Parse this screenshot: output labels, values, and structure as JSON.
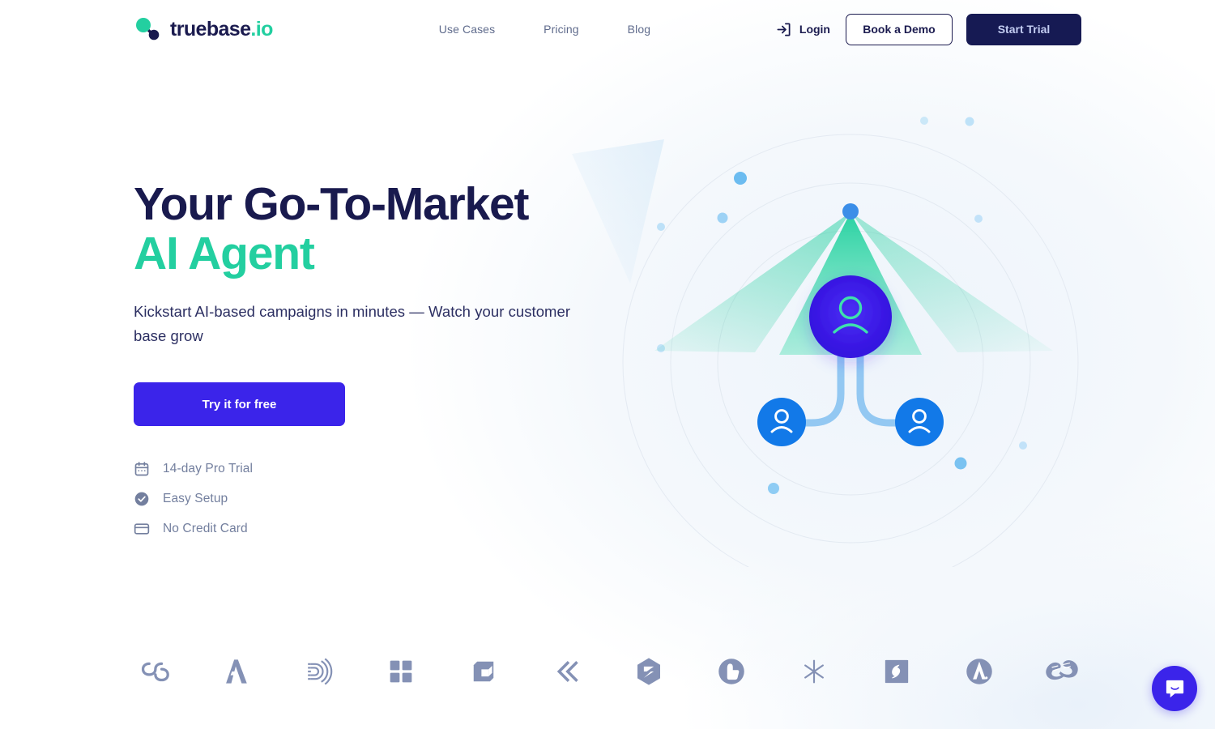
{
  "brand": {
    "name": "truebase",
    "suffix": ".io",
    "accent_teal": "#23cfa0",
    "navy": "#191a4e",
    "indigo": "#3b24ea",
    "blue": "#1279e8"
  },
  "header": {
    "nav": [
      {
        "label": "Use Cases",
        "name": "nav-use-cases"
      },
      {
        "label": "Pricing",
        "name": "nav-pricing"
      },
      {
        "label": "Blog",
        "name": "nav-blog"
      }
    ],
    "login_label": "Login",
    "demo_label": "Book a Demo",
    "trial_label": "Start Trial"
  },
  "hero": {
    "headline_line1": "Your Go-To-Market",
    "headline_line2": "AI Agent",
    "subtitle": "Kickstart AI-based campaigns in minutes — Watch your customer base grow",
    "cta_label": "Try it for free",
    "features": [
      {
        "icon": "calendar-icon",
        "label": "14-day Pro Trial"
      },
      {
        "icon": "check-circle-icon",
        "label": "Easy Setup"
      },
      {
        "icon": "credit-card-icon",
        "label": "No Credit Card"
      }
    ]
  },
  "illustration": {
    "center_node": "user-icon",
    "left_node": "user-icon",
    "right_node": "user-icon",
    "beam_color": "#2fd6a5",
    "center_circle_color": "#3b24ea",
    "node_circle_color": "#1279e8",
    "connector_color": "#93c8f2"
  },
  "clients": [
    {
      "name": "client-logo-loop",
      "icon": "loop-infinity-icon"
    },
    {
      "name": "client-logo-a-triangle",
      "icon": "a-triangle-icon"
    },
    {
      "name": "client-logo-fingerprint",
      "icon": "fingerprint-d-icon"
    },
    {
      "name": "client-logo-grid",
      "icon": "four-square-grid-icon"
    },
    {
      "name": "client-logo-cube",
      "icon": "cube-box-icon"
    },
    {
      "name": "client-logo-chevrons",
      "icon": "double-chevron-icon"
    },
    {
      "name": "client-logo-hexagon-z",
      "icon": "hexagon-z-icon"
    },
    {
      "name": "client-logo-thumb",
      "icon": "circle-thumb-icon"
    },
    {
      "name": "client-logo-asterisk",
      "icon": "asterisk-icon"
    },
    {
      "name": "client-logo-square-s",
      "icon": "square-s-icon"
    },
    {
      "name": "client-logo-circle-a",
      "icon": "circle-a-icon"
    },
    {
      "name": "client-logo-hands",
      "icon": "hands-leaf-icon"
    }
  ],
  "chat": {
    "icon": "chat-bubble-icon",
    "color": "#3b24ea"
  }
}
